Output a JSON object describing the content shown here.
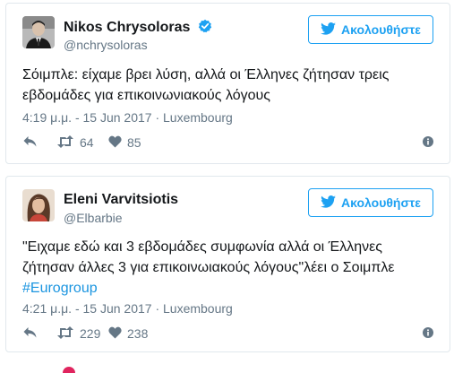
{
  "colors": {
    "brand": "#1da1f2",
    "hashtag": "#1b95e0",
    "muted": "#657786",
    "border": "#e1e8ed"
  },
  "tweets": [
    {
      "name": "Nikos Chrysoloras",
      "verified": true,
      "handle": "@nchrysoloras",
      "follow_label": "Ακολουθήστε",
      "text": "Σόιμπλε: είχαμε βρει λύση, αλλά οι Έλληνες ζήτησαν τρεις εβδομάδες για επικοινωνιακούς λόγους",
      "timestamp": "4:19 μ.μ. - 15 Jun 2017 · Luxembourg",
      "retweets": "64",
      "likes": "85"
    },
    {
      "name": "Eleni Varvitsiotis",
      "verified": false,
      "handle": "@Elbarbie",
      "follow_label": "Ακολουθήστε",
      "text": "\"Ειχαμε εδώ και 3 εβδομάδες συμφωνία αλλά οι Έλληνες ζήτησαν άλλες 3 για επικοινωιακούς λόγους\"λέει ο Σοιμπλε",
      "hashtag": "#Eurogroup",
      "timestamp": "4:21 μ.μ. - 15 Jun 2017 · Luxembourg",
      "retweets": "229",
      "likes": "238"
    }
  ],
  "icons": [
    "reply-icon",
    "retweet-icon",
    "like-icon",
    "info-icon",
    "twitter-bird-icon",
    "verified-badge-icon"
  ]
}
